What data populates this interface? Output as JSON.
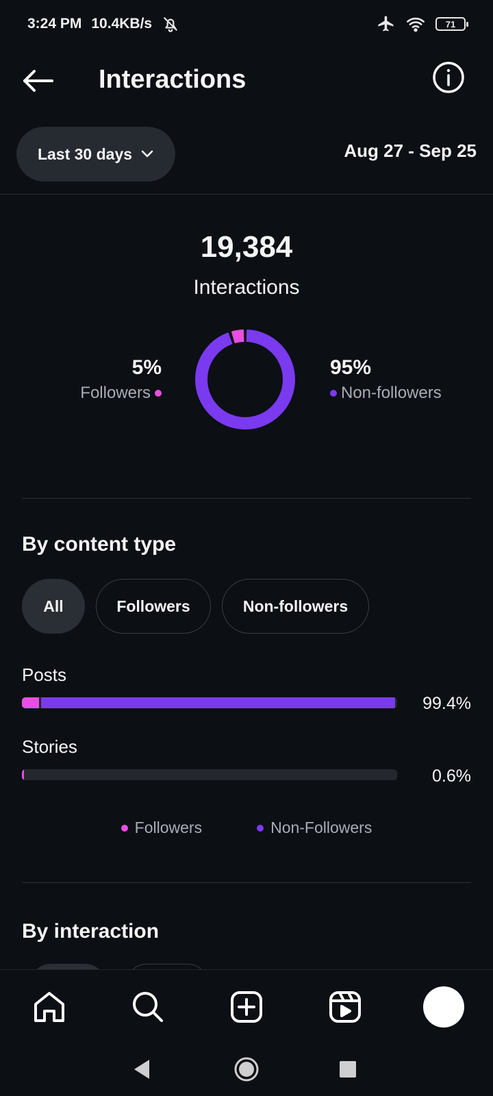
{
  "status_bar": {
    "time": "3:24 PM",
    "speed": "10.4KB/s",
    "battery": "71",
    "icons": [
      "bell-off-icon",
      "airplane-icon",
      "wifi-icon",
      "battery-icon"
    ]
  },
  "header": {
    "title": "Interactions"
  },
  "filter": {
    "range_label": "Last 30 days",
    "date_range": "Aug 27 - Sep 25"
  },
  "summary": {
    "total": "19,384",
    "label": "Interactions",
    "followers_pct": "5%",
    "followers_label": "Followers",
    "nonfollowers_pct": "95%",
    "nonfollowers_label": "Non-followers",
    "followers_share": 0.05,
    "nonfollowers_share": 0.95
  },
  "content_type": {
    "title": "By content type",
    "chips": [
      "All",
      "Followers",
      "Non-followers"
    ],
    "active_chip": "All",
    "rows": [
      {
        "label": "Posts",
        "value": "99.4%",
        "share": 0.994,
        "followers_share": 0.045
      },
      {
        "label": "Stories",
        "value": "0.6%",
        "share": 0.006,
        "followers_share": 0.006
      }
    ],
    "legend": [
      "Followers",
      "Non-Followers"
    ]
  },
  "interaction": {
    "title": "By interaction"
  },
  "colors": {
    "followers": "#e94ee3",
    "nonfollowers": "#7a3af0",
    "background": "#0c0f14"
  },
  "bottom_nav": [
    "home-icon",
    "search-icon",
    "create-icon",
    "reels-icon",
    "profile-avatar"
  ]
}
